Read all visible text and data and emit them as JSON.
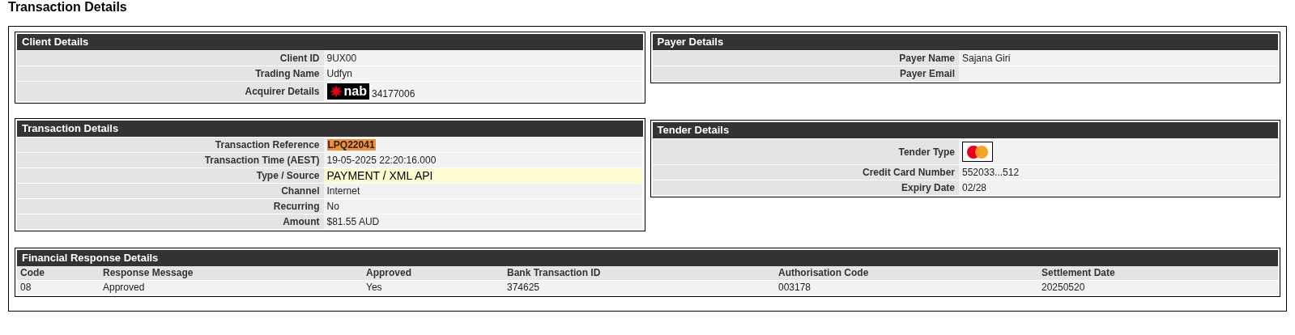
{
  "page_title": "Transaction Details",
  "left_column": [
    {
      "title": "Client Details",
      "rows": [
        {
          "label": "Client ID",
          "kind": "text",
          "value": "9UX00"
        },
        {
          "label": "Trading Name",
          "kind": "text",
          "value": "Udfyn"
        },
        {
          "label": "Acquirer Details",
          "kind": "logo",
          "logo_text": "nab",
          "value": "34177006"
        }
      ]
    },
    {
      "title": "Transaction Details",
      "rows": [
        {
          "label": "Transaction Reference",
          "kind": "highlight",
          "value": "LPQ22041"
        },
        {
          "label": "Transaction Time (AEST)",
          "kind": "text",
          "value": "19-05-2025 22:20:16.000"
        },
        {
          "label": "Type / Source",
          "kind": "emphasis",
          "value": "PAYMENT / XML API"
        },
        {
          "label": "Channel",
          "kind": "text",
          "value": "Internet"
        },
        {
          "label": "Recurring",
          "kind": "text",
          "value": "No"
        },
        {
          "label": "Amount",
          "kind": "text",
          "value": "$81.55 AUD"
        }
      ]
    }
  ],
  "right_column": [
    {
      "title": "Payer Details",
      "rows": [
        {
          "label": "Payer Name",
          "kind": "text",
          "value": "Sajana Giri"
        },
        {
          "label": "Payer Email",
          "kind": "text"
        }
      ]
    },
    {
      "title": "Tender Details",
      "rows": [
        {
          "label": "Tender Type",
          "kind": "card"
        },
        {
          "label": "Credit Card Number",
          "kind": "text",
          "value": "552033...512"
        },
        {
          "label": "Expiry Date",
          "kind": "text",
          "value": "02/28"
        }
      ]
    }
  ],
  "financial": {
    "title": "Financial Response Details",
    "columns": [
      "Code",
      "Response Message",
      "Approved",
      "Bank Transaction ID",
      "Authorisation Code",
      "Settlement Date"
    ],
    "rows": [
      [
        "08",
        "Approved",
        "Yes",
        "374625",
        "003178",
        "20250520"
      ]
    ]
  }
}
